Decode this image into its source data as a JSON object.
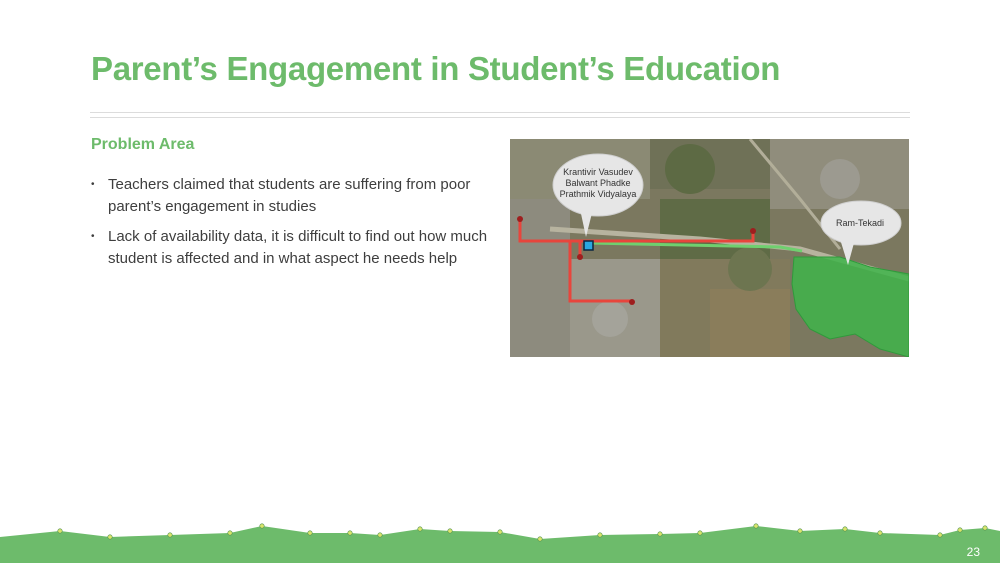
{
  "slide": {
    "title": "Parent’s Engagement in Student’s Education",
    "section_heading": "Problem Area",
    "bullets": [
      "Teachers claimed that students are suffering from poor parent’s  engagement in studies",
      "Lack of availability data, it is difficult to find out how much student is affected and in what aspect he needs help"
    ],
    "page_number": "23"
  },
  "map": {
    "school_label_lines": [
      "Krantivir Vasudev",
      "Balwant Phadke",
      "Prathmik Vidyalaya"
    ],
    "area_label": "Ram-Tekadi",
    "route_color": "#e8453c",
    "highlight_color": "#3fb44a"
  },
  "colors": {
    "accent": "#6dbb6b",
    "body_text": "#3e3e3e",
    "footer": "#6dbb6b",
    "footer_points": "#d9e56b"
  }
}
